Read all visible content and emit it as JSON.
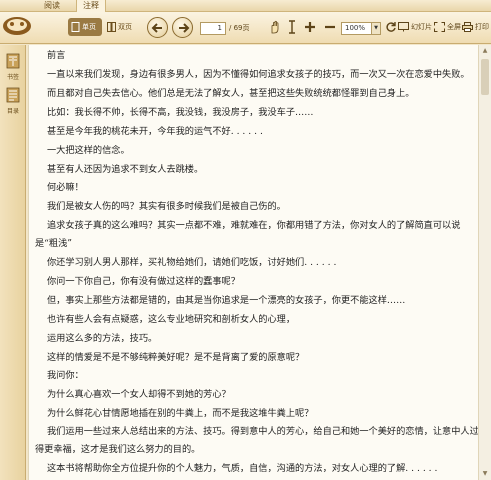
{
  "tabs": [
    "阅读",
    "注释"
  ],
  "toolbar": {
    "single_page": "单页",
    "double_page": "双页",
    "page_current": "1",
    "page_total": "/ 69页",
    "zoom": "100%",
    "slideshow": "幻灯片",
    "fullscreen": "全屏",
    "print": "打印"
  },
  "sidebar": {
    "items": [
      {
        "label": "书签",
        "icon": "bookmark-icon"
      },
      {
        "label": "目录",
        "icon": "toc-icon"
      }
    ]
  },
  "content": {
    "lines": [
      "前言",
      "一直以来我们发现，身边有很多男人，因为不懂得如何追求女孩子的技巧，而一次又一次在恋爱中失败。",
      "而且都对自己失去信心。他们总是无法了解女人，甚至把这些失败统统都怪罪到自己身上。",
      "比如：我长得不帅，长得不高，我没钱，我没房子，我没车子……",
      "甚至是今年我的桃花未开，今年我的运气不好. . . . . .",
      "一大把这样的信念。",
      "甚至有人还因为追求不到女人去跳楼。",
      "何必嘛！",
      "我们是被女人伤的吗？其实有很多时候我们是被自己伤的。",
      "追求女孩子真的这么难吗？其实一点都不难，难就难在，你都用错了方法，你对女人的了解简直可以说",
      "是“粗浅”",
      "你还学习别人男人那样，买礼物给她们，请她们吃饭，讨好她们. . . . . .",
      "你问一下你自己，你有没有做过这样的蠢事呢？",
      "但，事实上那些方法都是错的，由其是当你追求是一个漂亮的女孩子，你更不能这样……",
      "也许有些人会有点疑惑，这么专业地研究和剖析女人的心理，",
      "运用这么多的方法，技巧。",
      "这样的情爱是不是不够纯粹美好呢？是不是背离了爱的原意呢？",
      "我问你：",
      "为什么真心喜欢一个女人却得不到她的芳心？",
      "为什么鲜花心甘情愿地插在别的牛粪上，而不是我这堆牛粪上呢？",
      "我们运用一些过来人总结出来的方法、技巧。得到意中人的芳心，给自己和她一个美好的恋情，让意中人过",
      "得更幸福，这才是我们这么努力的目的。",
      "这本书将帮助你全方位提升你的个人魅力，气质，自信，沟通的方法，对女人心理的了解. . . . . ."
    ]
  }
}
